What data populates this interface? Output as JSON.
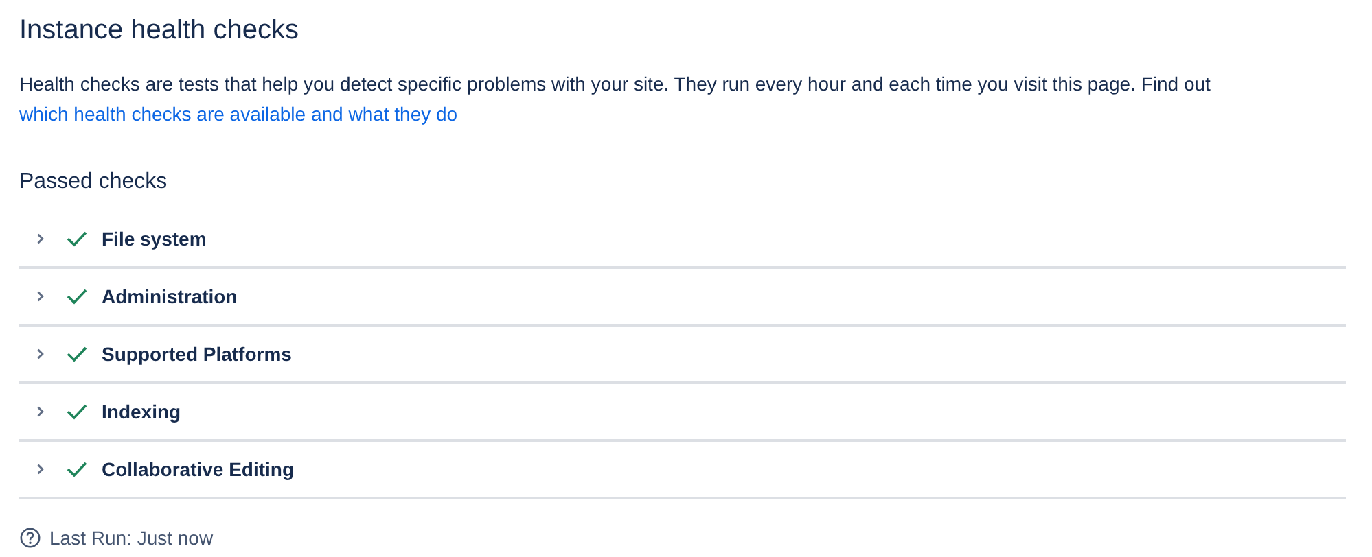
{
  "title": "Instance health checks",
  "description": {
    "text": "Health checks are tests that help you detect specific problems with your site. They run every hour and each time you visit this page. Find out ",
    "link": "which health checks are available and what they do"
  },
  "section_title": "Passed checks",
  "checks": [
    {
      "label": "File system",
      "passed": true,
      "expanded": false
    },
    {
      "label": "Administration",
      "passed": true,
      "expanded": false
    },
    {
      "label": "Supported Platforms",
      "passed": true,
      "expanded": false
    },
    {
      "label": "Indexing",
      "passed": true,
      "expanded": false
    },
    {
      "label": "Collaborative Editing",
      "passed": true,
      "expanded": false
    }
  ],
  "last_run": "Last Run: Just now"
}
